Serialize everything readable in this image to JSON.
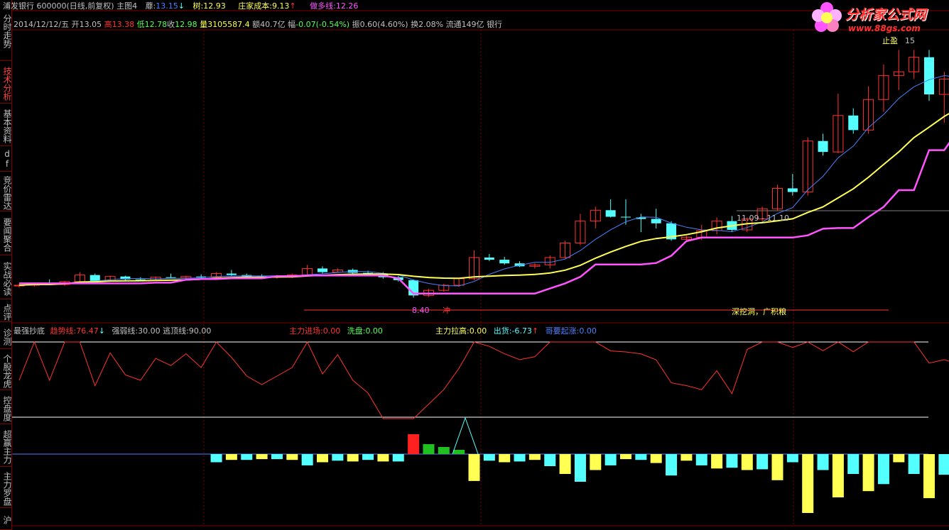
{
  "header": {
    "stock": "浦发银行 600000(日线,前复权) 主图4",
    "ma_label": "蘼:",
    "ma_value": "13.15",
    "ma_arrow": "↓",
    "tree_label": "树:",
    "tree_value": "12.93",
    "cost_label": "庄家成本:",
    "cost_value": "9.13",
    "cost_arrow": "↑",
    "bull_label": "做多线:",
    "bull_value": "12.26"
  },
  "ohlc": {
    "date": "2014/12/12/五",
    "open_label": "开",
    "open": "13.05",
    "high_label": "高",
    "high": "13.38",
    "low_label": "低",
    "low": "12.78",
    "close_label": "收",
    "close": "12.98",
    "vol_label": "量",
    "vol": "3105587.4",
    "amt_label": "额",
    "amt": "40.7亿",
    "chg_label": "幅",
    "chg": "-0.07(-0.54%)",
    "amp_label": "振",
    "amp": "0.60(4.60%)",
    "turn_label": "换",
    "turn": "2.08%",
    "float_label": "流通",
    "float": "149亿",
    "sector": "银行"
  },
  "annotations": {
    "cave": "深挖洞，广积粮",
    "range": "11.09 - 11.10",
    "low_price": "8.40",
    "chong": "冲",
    "top_tag": "止盈",
    "top_val": "15"
  },
  "indicator": {
    "name": "最强抄底",
    "trend_label": "趋势线:",
    "trend_value": "76.47",
    "trend_arrow": "↓",
    "strong_label": "强弱线:",
    "strong_value": "30.00",
    "escape_label": "逃顶线:",
    "escape_value": "90.00",
    "main_in_label": "主力进场:",
    "main_in_value": "0.00",
    "wash_label": "洗盘:",
    "wash_value": "0.00",
    "main_up_label": "主力拉高:",
    "main_up_value": "0.00",
    "ship_label": "出货:",
    "ship_value": "-6.73",
    "ship_arrow": "↑",
    "rise_label": "哥要起涨:",
    "rise_value": "0.00"
  },
  "sidebar": {
    "items": [
      {
        "label": "分时走势"
      },
      {
        "label": "技术分析"
      },
      {
        "label": "基本资料"
      },
      {
        "label": "dfcf"
      },
      {
        "label": "竞价雷达"
      },
      {
        "label": "要闻聚合"
      },
      {
        "label": "实战必读"
      },
      {
        "label": "点评"
      },
      {
        "label": "诊测"
      },
      {
        "label": "个股龙虎"
      },
      {
        "label": "控盘度"
      },
      {
        "label": "超赢主力"
      },
      {
        "label": "主力罗盘"
      },
      {
        "label": "沪"
      }
    ]
  },
  "logo": {
    "title": "分析家公式网",
    "url": "www.88gs.com"
  },
  "colors": {
    "up": "#ff3232",
    "down": "#54ffff",
    "yellow": "#ffff54",
    "magenta": "#ff54ff",
    "blue": "#4a80ff",
    "grid": "#800000"
  },
  "chart_data": {
    "type": "candlestick",
    "price_ylim": [
      8.0,
      15.5
    ],
    "candles": [
      [
        8.72,
        8.78,
        8.68,
        8.74
      ],
      [
        8.74,
        8.82,
        8.7,
        8.78
      ],
      [
        8.78,
        8.9,
        8.74,
        8.76
      ],
      [
        8.76,
        8.86,
        8.72,
        8.84
      ],
      [
        8.84,
        9.1,
        8.8,
        9.02
      ],
      [
        9.02,
        9.06,
        8.84,
        8.86
      ],
      [
        8.86,
        9.0,
        8.84,
        8.98
      ],
      [
        8.98,
        9.0,
        8.86,
        8.9
      ],
      [
        8.9,
        8.96,
        8.86,
        8.88
      ],
      [
        8.88,
        8.98,
        8.86,
        8.96
      ],
      [
        8.96,
        9.06,
        8.92,
        8.94
      ],
      [
        8.94,
        9.0,
        8.9,
        8.98
      ],
      [
        8.98,
        9.04,
        8.94,
        8.96
      ],
      [
        8.96,
        9.1,
        8.94,
        9.06
      ],
      [
        9.06,
        9.16,
        9.0,
        9.02
      ],
      [
        9.02,
        9.06,
        8.96,
        8.98
      ],
      [
        8.98,
        9.04,
        8.94,
        8.96
      ],
      [
        8.96,
        9.02,
        8.92,
        8.98
      ],
      [
        8.98,
        9.06,
        8.94,
        9.02
      ],
      [
        9.02,
        9.3,
        9.0,
        9.2
      ],
      [
        9.2,
        9.26,
        9.06,
        9.1
      ],
      [
        9.1,
        9.2,
        9.08,
        9.16
      ],
      [
        9.16,
        9.2,
        9.06,
        9.08
      ],
      [
        9.08,
        9.14,
        9.02,
        9.04
      ],
      [
        9.04,
        9.1,
        8.92,
        8.96
      ],
      [
        8.96,
        9.0,
        8.84,
        8.88
      ],
      [
        8.88,
        8.9,
        8.4,
        8.46
      ],
      [
        8.46,
        8.64,
        8.42,
        8.6
      ],
      [
        8.6,
        8.78,
        8.56,
        8.74
      ],
      [
        8.74,
        8.94,
        8.7,
        8.92
      ],
      [
        8.92,
        9.7,
        8.88,
        9.5
      ],
      [
        9.5,
        9.6,
        9.4,
        9.44
      ],
      [
        9.44,
        9.52,
        9.3,
        9.34
      ],
      [
        9.34,
        9.4,
        9.24,
        9.26
      ],
      [
        9.26,
        9.34,
        9.2,
        9.3
      ],
      [
        9.3,
        9.56,
        9.2,
        9.5
      ],
      [
        9.5,
        9.96,
        9.48,
        9.9
      ],
      [
        9.9,
        10.7,
        9.84,
        10.5
      ],
      [
        10.5,
        10.9,
        10.3,
        10.8
      ],
      [
        10.8,
        11.1,
        10.6,
        10.62
      ],
      [
        10.62,
        11.1,
        10.4,
        10.6
      ],
      [
        10.6,
        10.7,
        10.2,
        10.56
      ],
      [
        10.56,
        10.84,
        10.3,
        10.44
      ],
      [
        10.44,
        10.5,
        9.96,
        10.0
      ],
      [
        10.0,
        10.1,
        9.96,
        10.06
      ],
      [
        10.06,
        10.4,
        9.98,
        10.24
      ],
      [
        10.24,
        10.6,
        10.14,
        10.5
      ],
      [
        10.5,
        10.64,
        10.2,
        10.26
      ],
      [
        10.26,
        10.6,
        10.2,
        10.56
      ],
      [
        10.56,
        10.9,
        10.5,
        10.84
      ],
      [
        10.84,
        11.5,
        10.8,
        11.4
      ],
      [
        11.4,
        11.8,
        11.2,
        11.3
      ],
      [
        11.3,
        12.8,
        11.2,
        12.7
      ],
      [
        12.7,
        12.9,
        12.3,
        12.4
      ],
      [
        12.4,
        14.0,
        12.36,
        13.4
      ],
      [
        13.4,
        13.6,
        12.9,
        13.0
      ],
      [
        13.0,
        14.2,
        12.9,
        13.84
      ],
      [
        13.84,
        14.8,
        13.5,
        14.5
      ],
      [
        14.5,
        15.2,
        14.1,
        14.6
      ],
      [
        14.6,
        15.2,
        14.4,
        15.0
      ],
      [
        15.0,
        15.2,
        13.8,
        13.98
      ],
      [
        13.98,
        14.6,
        13.2,
        14.4
      ],
      [
        14.4,
        14.9,
        14.0,
        14.24
      ],
      [
        14.24,
        14.58,
        13.9,
        14.16
      ]
    ],
    "indicator_lines": {
      "trend_line_value": 76.47,
      "strong_line_value": 30.0,
      "escape_line_value": 90.0
    }
  }
}
